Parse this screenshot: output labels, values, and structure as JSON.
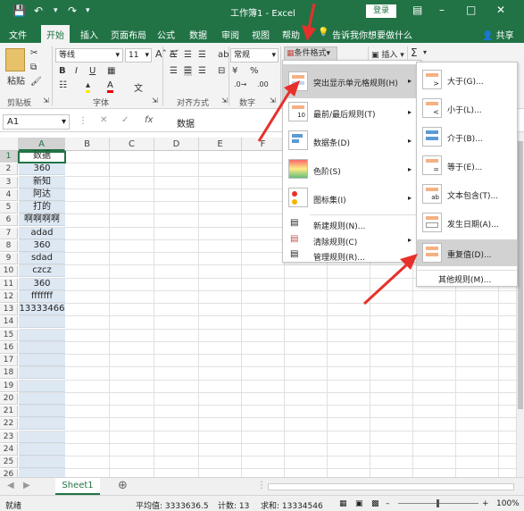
{
  "titlebar": {
    "title": "工作簿1 - Excel",
    "login": "登录",
    "save_icon": "save-icon",
    "undo_icon": "undo-icon",
    "redo_icon": "redo-icon"
  },
  "tabs": [
    "文件",
    "开始",
    "插入",
    "页面布局",
    "公式",
    "数据",
    "审阅",
    "视图",
    "帮助"
  ],
  "active_tab": "开始",
  "tellme": "告诉我你想要做什么",
  "share": "共享",
  "ribbon": {
    "paste": "粘贴",
    "font_name": "等线",
    "font_size": "11",
    "number_format": "常规",
    "cond_format": "条件格式",
    "insert": "插入",
    "sigma": "Σ",
    "groups": {
      "clipboard": "剪贴板",
      "font": "字体",
      "alignment": "对齐方式",
      "number": "数字"
    }
  },
  "formula_bar": {
    "name_box": "A1",
    "fx": "fx",
    "value": "数据"
  },
  "columns": [
    "A",
    "B",
    "C",
    "D",
    "E",
    "F"
  ],
  "rows": [
    "1",
    "2",
    "3",
    "4",
    "5",
    "6",
    "7",
    "8",
    "9",
    "10",
    "11",
    "12",
    "13",
    "14",
    "15",
    "16",
    "17",
    "18",
    "19",
    "20",
    "21",
    "22",
    "23",
    "24",
    "25",
    "26"
  ],
  "cells_A": [
    "数据",
    "360",
    "新知",
    "阿达",
    "打的",
    "啊啊啊啊",
    "adad",
    "360",
    "sdad",
    "czcz",
    "360",
    "fffffff",
    "13333466"
  ],
  "cond_menu": [
    {
      "label": "突出显示单元格规则(H)",
      "arrow": "▸"
    },
    {
      "label": "最前/最后规则(T)",
      "arrow": "▸"
    },
    {
      "label": "数据条(D)",
      "arrow": "▸"
    },
    {
      "label": "色阶(S)",
      "arrow": "▸"
    },
    {
      "label": "图标集(I)",
      "arrow": "▸"
    },
    {
      "label": "新建规则(N)..."
    },
    {
      "label": "清除规则(C)",
      "arrow": "▸"
    },
    {
      "label": "管理规则(R)..."
    }
  ],
  "submenu": [
    "大于(G)...",
    "小于(L)...",
    "介于(B)...",
    "等于(E)...",
    "文本包含(T)...",
    "发生日期(A)...",
    "重复值(D)..."
  ],
  "submenu_other": "其他规则(M)...",
  "sheet": {
    "tab": "Sheet1",
    "add": "⊕"
  },
  "status": {
    "ready": "就绪",
    "average": "平均值: 3333636.5",
    "count": "计数: 13",
    "sum": "求和: 13334546",
    "zoom": "100%"
  },
  "colors": {
    "excel_green": "#217346",
    "arrow_red": "#e8302a",
    "selection_fill": "#dde8f3",
    "menu_highlight": "#d2d2d2"
  }
}
